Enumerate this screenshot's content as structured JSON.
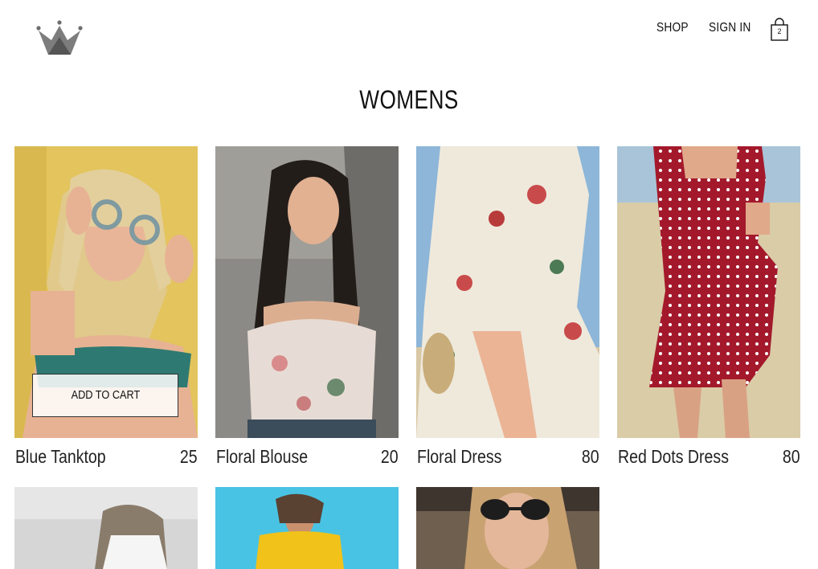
{
  "header": {
    "logo_icon": "crown-icon",
    "nav": {
      "shop": "SHOP",
      "sign_in": "SIGN IN"
    },
    "cart": {
      "icon": "shopping-bag-icon",
      "count": "2"
    }
  },
  "page": {
    "title": "WOMENS"
  },
  "products": [
    {
      "name": "Blue Tanktop",
      "price": "25",
      "add_to_cart": "ADD TO CART"
    },
    {
      "name": "Floral Blouse",
      "price": "20"
    },
    {
      "name": "Floral Dress",
      "price": "80"
    },
    {
      "name": "Red Dots Dress",
      "price": "80"
    }
  ],
  "colors": {
    "text": "#111111",
    "background": "#ffffff"
  }
}
